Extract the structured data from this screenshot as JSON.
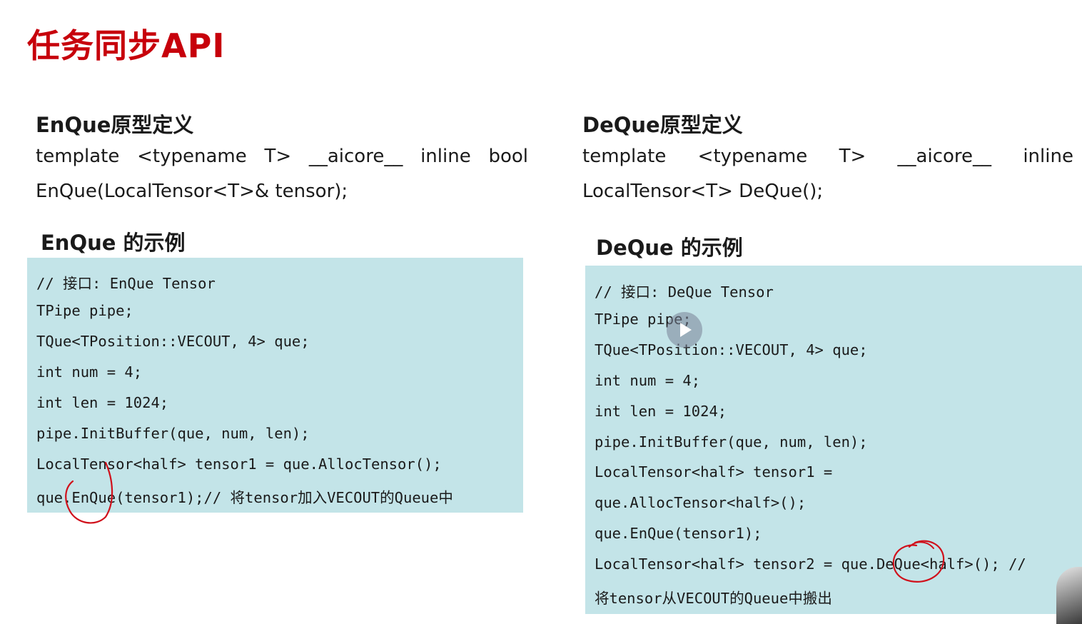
{
  "page": {
    "title": "任务同步API"
  },
  "enque": {
    "prototype_heading": "EnQue原型定义",
    "prototype_line1_tokens": [
      "template",
      "<typename",
      "T>",
      "__aicore__",
      "inline",
      "bool"
    ],
    "prototype_line2": "EnQue(LocalTensor<T>& tensor);",
    "example_heading": "EnQue 的示例",
    "code_lines": [
      "// 接口: EnQue Tensor",
      "TPipe pipe;",
      "TQue<TPosition::VECOUT, 4> que;",
      "int num = 4;",
      "int len = 1024;",
      "pipe.InitBuffer(que, num, len);",
      "LocalTensor<half> tensor1 = que.AllocTensor();",
      "que.EnQue(tensor1);// 将tensor加入VECOUT的Queue中"
    ]
  },
  "deque": {
    "prototype_heading": "DeQue原型定义",
    "prototype_line1_tokens": [
      "template",
      "<typename",
      "T>",
      "__aicore__",
      "inline"
    ],
    "prototype_line2": "LocalTensor<T> DeQue();",
    "example_heading": "DeQue 的示例",
    "code_lines": [
      "// 接口: DeQue Tensor",
      "TPipe pipe;",
      "TQue<TPosition::VECOUT, 4> que;",
      "int num = 4;",
      "int len = 1024;",
      "pipe.InitBuffer(que, num, len);",
      "LocalTensor<half> tensor1 =",
      "que.AllocTensor<half>();",
      "que.EnQue(tensor1);",
      "LocalTensor<half> tensor2 = que.DeQue<half>(); //",
      "将tensor从VECOUT的Queue中搬出"
    ]
  },
  "colors": {
    "title": "#c7000b",
    "code_background": "#c3e4e8",
    "annotation": "#d0101b"
  },
  "icons": {
    "video_overlay": "play-icon"
  }
}
